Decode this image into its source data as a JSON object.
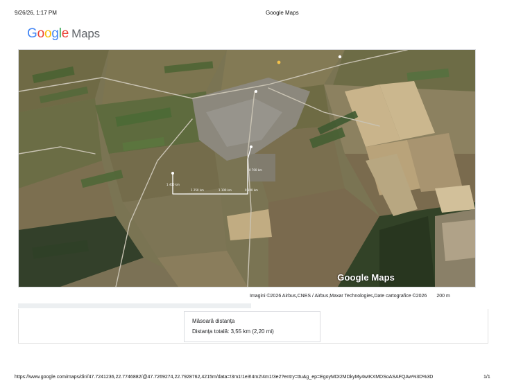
{
  "print_header": {
    "datetime": "9/26/26, 1:17 PM",
    "page_title": "Google Maps"
  },
  "logo": {
    "google": "Google",
    "maps": "Maps",
    "colors": [
      "#4285F4",
      "#EA4335",
      "#FBBC05",
      "#4285F4",
      "#34A853",
      "#EA4335"
    ]
  },
  "map": {
    "type": "satellite imagery",
    "watermark": "Google Maps",
    "route_color": "#ffffff",
    "segment_labels": [
      "1 400 km",
      "1 250 km",
      "1 100 km",
      "0 700 km",
      "0 100 km"
    ]
  },
  "attribution": {
    "text": "Imagini ©2026 Airbus,CNES / Airbus,Maxar Technologies,Date cartografice ©2026",
    "scale": "200 m"
  },
  "measure": {
    "title": "Măsoară distanța",
    "total": "Distanța totală: 3,55 km (2,20 mi)"
  },
  "print_footer": {
    "url": "https://www.google.com/maps/dir//47.7241236,22.7746882/@47.7269274,22.7928762,4215m/data=!3m1!1e3!4m2!4m1!3e2?entry=ttu&g_ep=EgoyMDI2MDkyMy4wIKXMDSoASAFQAw%3D%3D",
    "page": "1/1"
  }
}
